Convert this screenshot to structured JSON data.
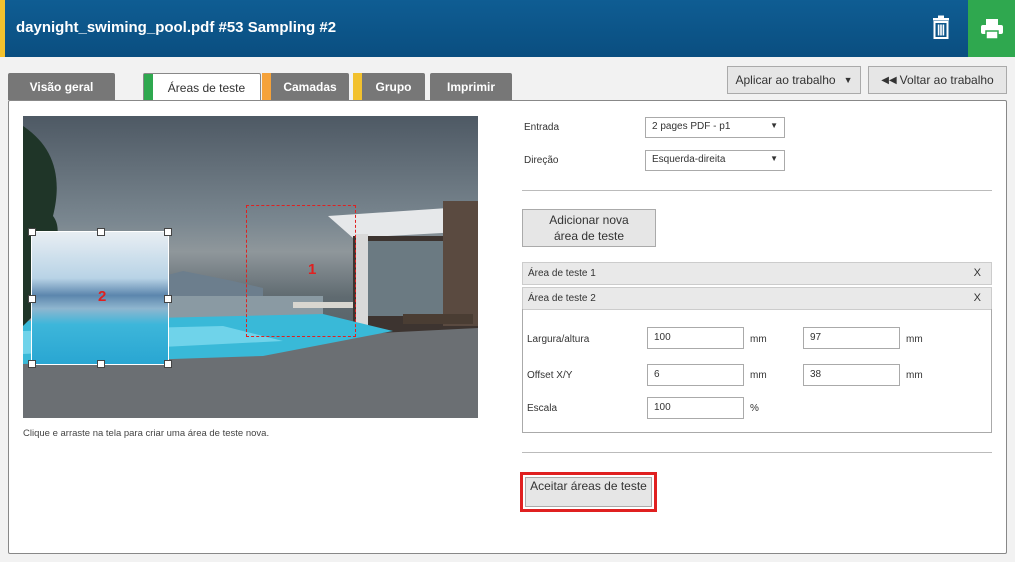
{
  "header": {
    "title": "daynight_swiming_pool.pdf #53 Sampling #2",
    "accent_color": "#f2c12e",
    "print_color": "#2fa84f"
  },
  "tabs": [
    {
      "label": "Visão geral",
      "stripe": ""
    },
    {
      "label": "Áreas de teste",
      "stripe": "#2fa84f"
    },
    {
      "label": "Camadas",
      "stripe": "#f5a23a"
    },
    {
      "label": "Grupo",
      "stripe": "#f2c12e"
    },
    {
      "label": "Imprimir",
      "stripe": ""
    }
  ],
  "toolbar": {
    "apply_label": "Aplicar ao trabalho",
    "back_label": "Voltar ao trabalho"
  },
  "canvas": {
    "area1_label": "1",
    "area2_label": "2",
    "hint": "Clique e arraste na tela para criar uma área de teste nova."
  },
  "form": {
    "entrada_label": "Entrada",
    "entrada_value": "2 pages PDF - p1",
    "direcao_label": "Direção",
    "direcao_value": "Esquerda-direita",
    "add_button": "Adicionar nova área de teste",
    "area1": "Área de teste 1",
    "area2": "Área de teste 2",
    "close": "X",
    "size_label": "Largura/altura",
    "width": "100",
    "height": "97",
    "offset_label": "Offset X/Y",
    "offset_x": "6",
    "offset_y": "38",
    "scale_label": "Escala",
    "scale": "100",
    "unit_mm": "mm",
    "unit_pct": "%",
    "accept_button": "Aceitar áreas de teste"
  }
}
